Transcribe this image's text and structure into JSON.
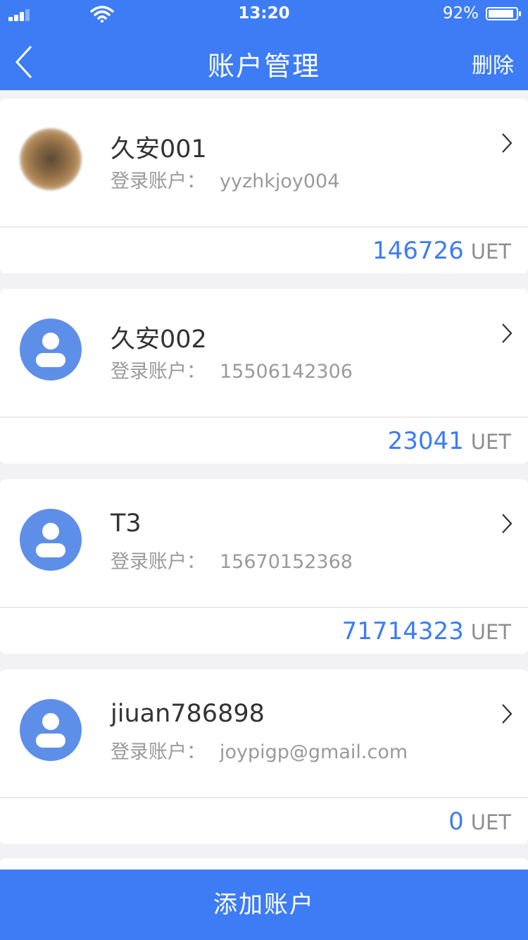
{
  "status_bar": {
    "time": "13:20",
    "battery": "92%",
    "battery_level": 0.92
  },
  "header": {
    "title": "账户管理",
    "delete_label": "删除"
  },
  "accounts": [
    {
      "name": "久安001",
      "login_label": "登录账户：",
      "login_value": "yyzhkjoy004",
      "balance": "146726",
      "unit": "UET",
      "avatar": "photo"
    },
    {
      "name": "久安002",
      "login_label": "登录账户：",
      "login_value": "15506142306",
      "balance": "23041",
      "unit": "UET",
      "avatar": "person-icon"
    },
    {
      "name": "T3",
      "login_label": "登录账户：",
      "login_value": "15670152368",
      "balance": "71714323",
      "unit": "UET",
      "avatar": "person-icon"
    },
    {
      "name": "jiuan786898",
      "login_label": "登录账户：",
      "login_value": "joypigp@gmail.com",
      "balance": "0",
      "unit": "UET",
      "avatar": "person-icon"
    }
  ],
  "footer": {
    "add_label": "添加账户"
  },
  "colors": {
    "accent": "#3d7cf5",
    "avatar_bg": "#5e8fe8",
    "background": "#f2f2f4"
  }
}
